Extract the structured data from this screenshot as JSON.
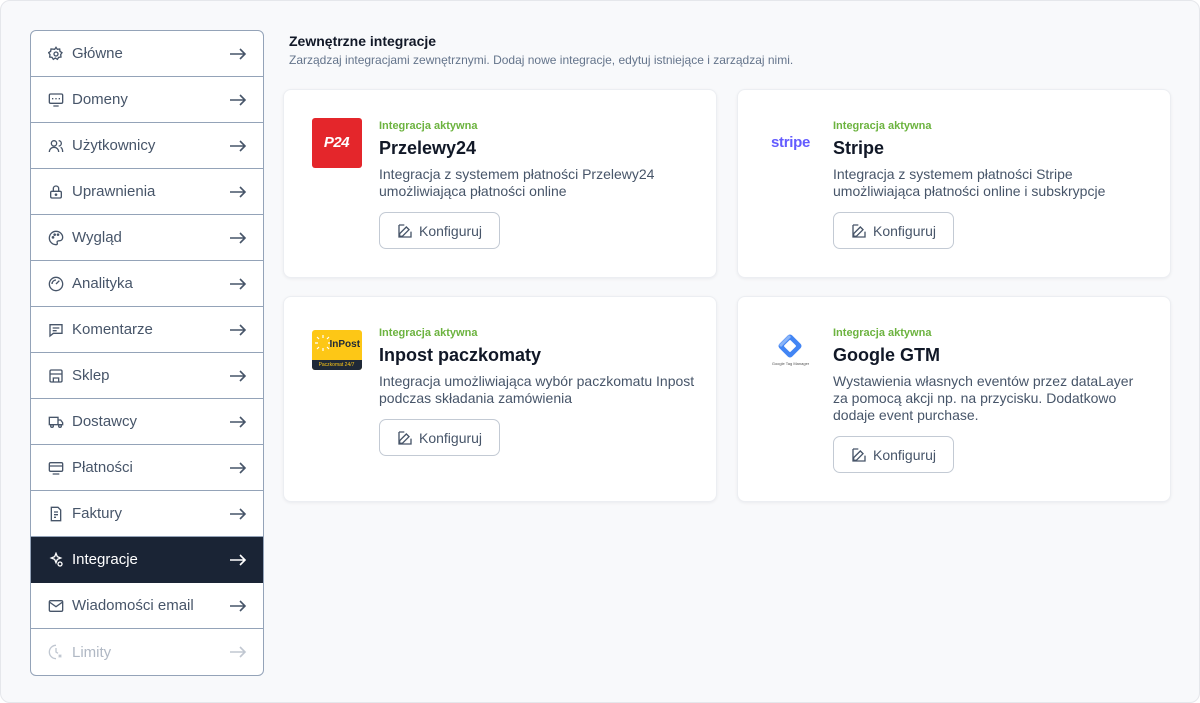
{
  "sidebar": {
    "items": [
      {
        "label": "Główne",
        "icon": "gear-icon"
      },
      {
        "label": "Domeny",
        "icon": "domain-icon"
      },
      {
        "label": "Użytkownicy",
        "icon": "users-icon"
      },
      {
        "label": "Uprawnienia",
        "icon": "lock-icon"
      },
      {
        "label": "Wygląd",
        "icon": "palette-icon"
      },
      {
        "label": "Analityka",
        "icon": "gauge-icon"
      },
      {
        "label": "Komentarze",
        "icon": "comment-icon"
      },
      {
        "label": "Sklep",
        "icon": "store-icon"
      },
      {
        "label": "Dostawcy",
        "icon": "truck-icon"
      },
      {
        "label": "Płatności",
        "icon": "payment-icon"
      },
      {
        "label": "Faktury",
        "icon": "invoice-icon"
      },
      {
        "label": "Integracje",
        "icon": "integrations-icon",
        "active": true
      },
      {
        "label": "Wiadomości email",
        "icon": "mail-icon"
      },
      {
        "label": "Limity",
        "icon": "limits-icon",
        "disabled": true
      }
    ]
  },
  "header": {
    "title": "Zewnętrzne integracje",
    "subtitle": "Zarządzaj integracjami zewnętrznymi. Dodaj nowe integracje, edytuj istniejące i zarządzaj nimi."
  },
  "integrations": [
    {
      "name": "Przelewy24",
      "status": "Integracja aktywna",
      "description": "Integracja z systemem płatności Przelewy24 umożliwiająca płatności online",
      "button": "Konfiguruj",
      "logo_text": "P24",
      "logo_color": "#e4262b"
    },
    {
      "name": "Stripe",
      "status": "Integracja aktywna",
      "description": "Integracja z systemem płatności Stripe umożliwiająca płatności online i subskrypcje",
      "button": "Konfiguruj",
      "logo_text": "stripe",
      "logo_color": "#635bff"
    },
    {
      "name": "Inpost paczkomaty",
      "status": "Integracja aktywna",
      "description": "Integracja umożliwiająca wybór paczkomatu Inpost podczas składania zamówienia",
      "button": "Konfiguruj",
      "logo_text": "InPost",
      "logo_subtext": "Paczkomat 24/7",
      "logo_color": "#fdc716"
    },
    {
      "name": "Google GTM",
      "status": "Integracja aktywna",
      "description": "Wystawienia własnych eventów przez dataLayer za pomocą akcji np. na przycisku. Dodatkowo dodaje event purchase.",
      "button": "Konfiguruj",
      "logo_subtext": "Google Tag Manager",
      "logo_color": "#4285f4"
    }
  ],
  "colors": {
    "active_nav_bg": "#1a2435",
    "status_green": "#6cb33f",
    "border": "#94a3b8"
  }
}
